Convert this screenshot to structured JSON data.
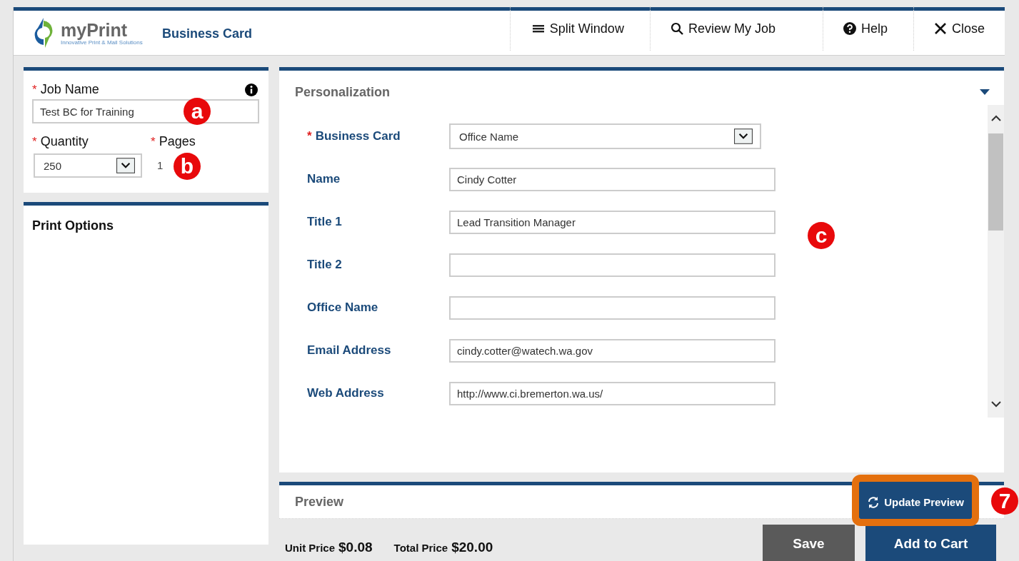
{
  "header": {
    "logo": {
      "name": "myPrint",
      "tagline": "Innovative Print & Mail Solutions"
    },
    "title": "Business Card",
    "nav": [
      {
        "label": "Split Window"
      },
      {
        "label": "Review My Job"
      },
      {
        "label": "Help"
      },
      {
        "label": "Close"
      }
    ]
  },
  "job": {
    "label": "Job Name",
    "marker": "*",
    "value": "Test BC for Training",
    "callout": "a"
  },
  "quantity": {
    "label": "Quantity",
    "marker": "*",
    "value": "250"
  },
  "pages": {
    "label": "Pages",
    "marker": "*",
    "value": "1",
    "callout": "b"
  },
  "print_options": {
    "title": "Print Options"
  },
  "personalization": {
    "title": "Personalization",
    "callout": "c",
    "fields": [
      {
        "kind": "select",
        "label": "Business Card",
        "marker": "*",
        "value": "Office Name"
      },
      {
        "kind": "text",
        "label": "Name",
        "value": "Cindy Cotter"
      },
      {
        "kind": "text",
        "label": "Title 1",
        "value": "Lead Transition Manager"
      },
      {
        "kind": "text",
        "label": "Title 2"
      },
      {
        "kind": "text",
        "label": "Office Name"
      },
      {
        "kind": "text",
        "label": "Email Address",
        "value": "cindy.cotter@watech.wa.gov"
      },
      {
        "kind": "text",
        "label": "Web Address",
        "value": "http://www.ci.bremerton.wa.us/"
      }
    ]
  },
  "preview": {
    "title": "Preview",
    "button": "Update Preview",
    "highlighted": true,
    "callout": "7"
  },
  "footer": {
    "unit_price_label": "Unit Price",
    "unit_price": "$0.08",
    "total_price_label": "Total Price",
    "total_price": "$20.00",
    "buttons": [
      {
        "kind": "secondary",
        "label": "Save"
      },
      {
        "kind": "primary",
        "label": "Add to Cart"
      }
    ]
  }
}
